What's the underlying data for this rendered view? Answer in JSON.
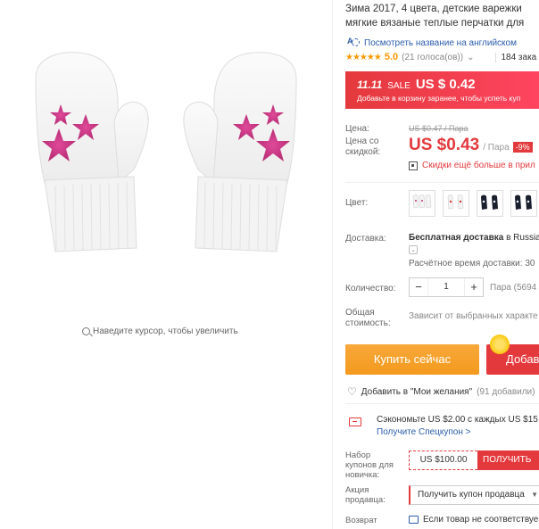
{
  "gallery": {
    "zoom_hint": "Наведите курсор, чтобы увеличить"
  },
  "product": {
    "title_line1": "Зима 2017, 4 цвета, детские варежки",
    "title_line2": "мягкие вязаные теплые перчатки для",
    "translate_link": "Посмотреть название на английском",
    "stars": "★★★★★",
    "rating": "5.0",
    "votes": "(21 голоса(ов))",
    "votes_caret": "⌄",
    "orders": "184 зака"
  },
  "sale": {
    "badge": "11.11",
    "word": "SALE",
    "price": "US $ 0.42",
    "note": "Добавьте в корзину заранее, чтобы успеть куп"
  },
  "pricing": {
    "price_label": "Цена:",
    "old_price": "US $0.47 / Пара",
    "discount_label": "Цена со скидкой:",
    "current_price": "US $0.43",
    "per_unit": "/ Пара",
    "discount_badge": "-9%",
    "app_discount": "Скидки ещё больше в прил"
  },
  "options": {
    "color_label": "Цвет:",
    "colors": [
      "white-pink-stars",
      "white-red-hearts",
      "black-white-1",
      "black-white-2"
    ],
    "shipping_label": "Доставка:",
    "shipping_value_bold": "Бесплатная доставка",
    "shipping_value_rest": " в Russia",
    "shipping_chevron": "⌄",
    "shipping_time": "Расчётное время доставки: 30",
    "quantity_label": "Количество:",
    "quantity_minus": "−",
    "quantity_value": "1",
    "quantity_plus": "+",
    "quantity_note": "Пара (5694 П",
    "total_label_1": "Общая",
    "total_label_2": "стоимость:",
    "total_note": "Зависит от выбранных характе"
  },
  "actions": {
    "buy_now": "Купить сейчас",
    "add_to_cart": "Добав",
    "wishlist_icon": "♡",
    "wishlist": "Добавить в \"Мои желания\"",
    "wishlist_count": "(91 добавили)"
  },
  "coupons": {
    "save_text": "Сэкономьте US $2.00 с каждых US $15.",
    "special_link": "Получите Спецкупон >",
    "new_user_label_1": "Набор",
    "new_user_label_2": "купонов для",
    "new_user_label_3": "новичка:",
    "new_user_value": "US $100.00",
    "new_user_button": "ПОЛУЧИТЬ",
    "seller_label_1": "Акция",
    "seller_label_2": "продавца:",
    "seller_select": "Получить купон продавца",
    "seller_caret": "▼",
    "return_label": "Возврат",
    "return_text": "Если товар не соответствуе"
  },
  "colors": {
    "accent_red": "#e4393c",
    "buy_orange": "#f39a1e",
    "link_blue": "#2b5cab",
    "star_pink": "#c2307a"
  }
}
